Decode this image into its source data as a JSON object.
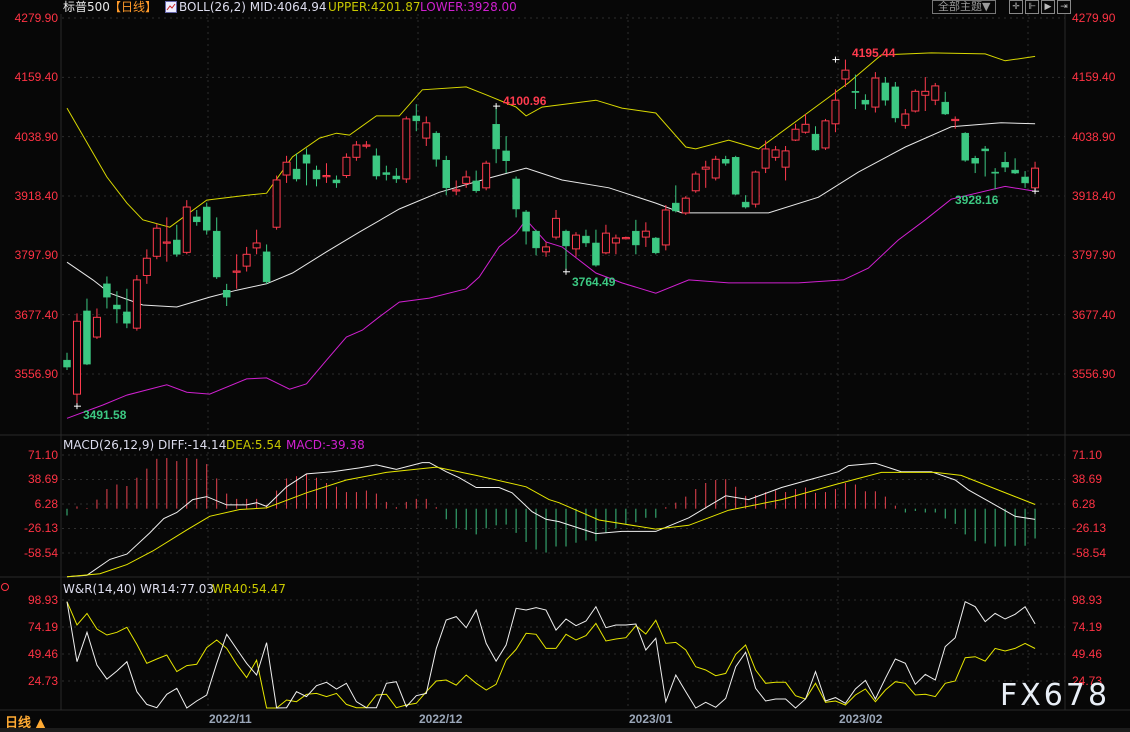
{
  "header": {
    "symbol": "标普500",
    "period": "【日线】",
    "boll": "BOLL(26,2) MID:4064.94",
    "upper": "UPPER:4201.87",
    "lower": "LOWER:3928.00",
    "theme_button": "全部主题▼"
  },
  "macd_header": {
    "name": "MACD(26,12,9) DIFF:-14.14",
    "dea": "DEA:5.54",
    "macd": "MACD:-39.38"
  },
  "wr_header": {
    "name": "W&R(14,40) WR14:77.03",
    "wr40": "WR40:54.47"
  },
  "price_axis": [
    "4279.90",
    "4159.40",
    "4038.90",
    "3918.40",
    "3797.90",
    "3677.40",
    "3556.90"
  ],
  "macd_axis": [
    "71.10",
    "38.69",
    "6.28",
    "-26.13",
    "-58.54"
  ],
  "wr_axis": [
    "98.93",
    "74.19",
    "49.46",
    "24.73"
  ],
  "dates": [
    "2022/11",
    "2022/12",
    "2023/01",
    "2023/02"
  ],
  "period_selector": "日线 ▲",
  "watermark": "FX678",
  "annotations": {
    "high1": "4195.44",
    "high2": "4100.96",
    "low1": "3764.49",
    "low2": "3928.16",
    "low3": "3491.58"
  },
  "colors": {
    "up": "#ff3b4e",
    "down": "#3cc882",
    "mid": "#e8e8e8",
    "upper": "#d8d800",
    "lower": "#d020d0",
    "axis": "#ff3344"
  },
  "chart_data": {
    "type": "candlestick",
    "title": "标普500 日线",
    "price_range": [
      3491.58,
      4279.9
    ],
    "candles_ohlc": [
      [
        3585,
        3600,
        3565,
        3571
      ],
      [
        3516,
        3680,
        3491.58,
        3664
      ],
      [
        3685,
        3710,
        3575,
        3577
      ],
      [
        3632,
        3690,
        3628,
        3672
      ],
      [
        3740,
        3755,
        3690,
        3713
      ],
      [
        3697,
        3725,
        3660,
        3689
      ],
      [
        3683,
        3730,
        3650,
        3660
      ],
      [
        3650,
        3758,
        3645,
        3748
      ],
      [
        3757,
        3810,
        3740,
        3792
      ],
      [
        3796,
        3862,
        3790,
        3853
      ],
      [
        3823,
        3875,
        3785,
        3825
      ],
      [
        3829,
        3860,
        3795,
        3800
      ],
      [
        3804,
        3910,
        3800,
        3896
      ],
      [
        3876,
        3890,
        3858,
        3866
      ],
      [
        3896,
        3905,
        3840,
        3849
      ],
      [
        3847,
        3875,
        3750,
        3754
      ],
      [
        3727,
        3740,
        3695,
        3713
      ],
      [
        3764,
        3800,
        3730,
        3766
      ],
      [
        3776,
        3815,
        3765,
        3800
      ],
      [
        3813,
        3850,
        3800,
        3823
      ],
      [
        3805,
        3820,
        3740,
        3744
      ],
      [
        3855,
        3960,
        3850,
        3951
      ],
      [
        3961,
        4000,
        3945,
        3987
      ],
      [
        3973,
        4005,
        3948,
        3953
      ],
      [
        4002,
        4015,
        3940,
        3985
      ],
      [
        3971,
        3980,
        3938,
        3953
      ],
      [
        3959,
        3985,
        3945,
        3960
      ],
      [
        3951,
        3960,
        3935,
        3945
      ],
      [
        3960,
        4005,
        3955,
        3997
      ],
      [
        3997,
        4030,
        3990,
        4022
      ],
      [
        4020,
        4030,
        4015,
        4022
      ],
      [
        4000,
        4015,
        3952,
        3959
      ],
      [
        3966,
        3980,
        3950,
        3962
      ],
      [
        3959,
        3975,
        3945,
        3953
      ],
      [
        3953,
        4080,
        3945,
        4075
      ],
      [
        4081,
        4105,
        4050,
        4071
      ],
      [
        4036,
        4080,
        4020,
        4067
      ],
      [
        4046,
        4050,
        3978,
        3993
      ],
      [
        3991,
        4000,
        3920,
        3935
      ],
      [
        3929,
        3950,
        3920,
        3931
      ],
      [
        3944,
        3970,
        3935,
        3957
      ],
      [
        3949,
        3970,
        3925,
        3929
      ],
      [
        3935,
        3990,
        3930,
        3985
      ],
      [
        4064,
        4100.96,
        3985,
        4014
      ],
      [
        4010,
        4040,
        3965,
        3990
      ],
      [
        3953,
        3958,
        3875,
        3892
      ],
      [
        3886,
        3890,
        3820,
        3847
      ],
      [
        3847,
        3850,
        3798,
        3813
      ],
      [
        3805,
        3825,
        3795,
        3815
      ],
      [
        3835,
        3890,
        3830,
        3873
      ],
      [
        3847,
        3850,
        3764.49,
        3817
      ],
      [
        3811,
        3845,
        3795,
        3839
      ],
      [
        3837,
        3850,
        3815,
        3823
      ],
      [
        3823,
        3850,
        3775,
        3778
      ],
      [
        3803,
        3860,
        3800,
        3843
      ],
      [
        3823,
        3840,
        3800,
        3833
      ],
      [
        3832,
        3836,
        3830,
        3834
      ],
      [
        3847,
        3870,
        3800,
        3819
      ],
      [
        3835,
        3865,
        3815,
        3847
      ],
      [
        3833,
        3835,
        3800,
        3803
      ],
      [
        3819,
        3900,
        3808,
        3890
      ],
      [
        3904,
        3940,
        3885,
        3888
      ],
      [
        3884,
        3918,
        3880,
        3914
      ],
      [
        3929,
        3968,
        3925,
        3963
      ],
      [
        3973,
        3990,
        3935,
        3977
      ],
      [
        3955,
        4000,
        3950,
        3993
      ],
      [
        3993,
        4000,
        3980,
        3985
      ],
      [
        3997,
        4000,
        3920,
        3922
      ],
      [
        3906,
        3920,
        3893,
        3896
      ],
      [
        3902,
        3970,
        3895,
        3967
      ],
      [
        3975,
        4031,
        3965,
        4014
      ],
      [
        3997,
        4020,
        3990,
        4012
      ],
      [
        3977,
        4020,
        3950,
        4010
      ],
      [
        4032,
        4065,
        4030,
        4054
      ],
      [
        4048,
        4085,
        4045,
        4064
      ],
      [
        4044,
        4060,
        4010,
        4012
      ],
      [
        4016,
        4075,
        4012,
        4071
      ],
      [
        4065,
        4135,
        4048,
        4113
      ],
      [
        4156,
        4195.44,
        4140,
        4174
      ],
      [
        4131,
        4165,
        4095,
        4130
      ],
      [
        4113,
        4125,
        4093,
        4105
      ],
      [
        4099,
        4170,
        4088,
        4158
      ],
      [
        4148,
        4160,
        4102,
        4113
      ],
      [
        4140,
        4150,
        4068,
        4077
      ],
      [
        4062,
        4095,
        4055,
        4085
      ],
      [
        4091,
        4135,
        4088,
        4131
      ],
      [
        4123,
        4160,
        4091,
        4131
      ],
      [
        4113,
        4148,
        4103,
        4142
      ],
      [
        4109,
        4130,
        4083,
        4085
      ],
      [
        4072,
        4080,
        4055,
        4074
      ],
      [
        4046,
        4048,
        3988,
        3991
      ],
      [
        3995,
        4000,
        3965,
        3985
      ],
      [
        4014,
        4020,
        3958,
        4010
      ],
      [
        3967,
        3975,
        3932,
        3966
      ],
      [
        3987,
        4008,
        3967,
        3977
      ],
      [
        3971,
        3995,
        3963,
        3965
      ],
      [
        3957,
        3969,
        3935,
        3945
      ],
      [
        3935,
        3988,
        3928.16,
        3975
      ]
    ],
    "boll_upper": [
      [
        0,
        4097
      ],
      [
        4,
        3957
      ],
      [
        6,
        3904
      ],
      [
        7.6,
        3870
      ],
      [
        10.3,
        3855
      ],
      [
        14,
        3910
      ],
      [
        18,
        3920
      ],
      [
        20,
        3924
      ],
      [
        22.6,
        3998
      ],
      [
        25.3,
        4036
      ],
      [
        27,
        4046
      ],
      [
        28.3,
        4042
      ],
      [
        31,
        4081
      ],
      [
        33.3,
        4081
      ],
      [
        35.6,
        4134
      ],
      [
        40,
        4140
      ],
      [
        42,
        4124
      ],
      [
        45,
        4099
      ],
      [
        46,
        4081
      ],
      [
        47.6,
        4099
      ],
      [
        53,
        4113
      ],
      [
        55.6,
        4097
      ],
      [
        59,
        4087
      ],
      [
        62,
        4018
      ],
      [
        63,
        4014
      ],
      [
        66.3,
        4032
      ],
      [
        69.3,
        4014
      ],
      [
        74.6,
        4093
      ],
      [
        78.3,
        4148
      ],
      [
        81.6,
        4205
      ],
      [
        86.6,
        4209
      ],
      [
        92,
        4207
      ],
      [
        94,
        4193
      ],
      [
        97,
        4201.87
      ]
    ],
    "boll_mid": [
      [
        0,
        3784
      ],
      [
        2.6,
        3748
      ],
      [
        4.3,
        3721
      ],
      [
        7.6,
        3697
      ],
      [
        11,
        3693
      ],
      [
        14.3,
        3713
      ],
      [
        17,
        3727
      ],
      [
        20,
        3740
      ],
      [
        22.6,
        3762
      ],
      [
        26,
        3805
      ],
      [
        29.3,
        3845
      ],
      [
        33.3,
        3892
      ],
      [
        37.3,
        3926
      ],
      [
        42.3,
        3955
      ],
      [
        46,
        3975
      ],
      [
        49.6,
        3951
      ],
      [
        54.3,
        3935
      ],
      [
        59,
        3904
      ],
      [
        61.6,
        3884
      ],
      [
        66.3,
        3884
      ],
      [
        70.3,
        3884
      ],
      [
        75.3,
        3916
      ],
      [
        79.3,
        3967
      ],
      [
        84,
        4018
      ],
      [
        88.6,
        4059
      ],
      [
        93.6,
        4067
      ],
      [
        97,
        4064.94
      ]
    ],
    "boll_lower": [
      [
        0,
        3467
      ],
      [
        3.6,
        3494
      ],
      [
        6,
        3514
      ],
      [
        10,
        3535
      ],
      [
        12,
        3520
      ],
      [
        14.3,
        3516
      ],
      [
        18,
        3547
      ],
      [
        20,
        3549
      ],
      [
        22.3,
        3526
      ],
      [
        24,
        3537
      ],
      [
        26,
        3585
      ],
      [
        28,
        3632
      ],
      [
        29.6,
        3646
      ],
      [
        31.3,
        3673
      ],
      [
        33.3,
        3703
      ],
      [
        36.3,
        3711
      ],
      [
        40,
        3730
      ],
      [
        41.3,
        3754
      ],
      [
        43.3,
        3815
      ],
      [
        45,
        3843
      ],
      [
        46,
        3870
      ],
      [
        48,
        3825
      ],
      [
        49.6,
        3815
      ],
      [
        53,
        3762
      ],
      [
        55.6,
        3742
      ],
      [
        59,
        3721
      ],
      [
        62.3,
        3748
      ],
      [
        66.3,
        3742
      ],
      [
        69.3,
        3742
      ],
      [
        73.3,
        3742
      ],
      [
        77.8,
        3748
      ],
      [
        80.3,
        3772
      ],
      [
        83.3,
        3829
      ],
      [
        86,
        3870
      ],
      [
        88.6,
        3912
      ],
      [
        94,
        3938
      ],
      [
        97,
        3928
      ]
    ],
    "macd_hist": [
      -9,
      3,
      1,
      12,
      26,
      32,
      30,
      41,
      53,
      66,
      67,
      63,
      67,
      66,
      59,
      40,
      20,
      13,
      13,
      13,
      5,
      24,
      40,
      43,
      46,
      41,
      34,
      29,
      22,
      22,
      24,
      20,
      9,
      2,
      9,
      13,
      13,
      2,
      -14,
      -26,
      -28,
      -34,
      -26,
      -22,
      -21,
      -32,
      -44,
      -54,
      -58,
      -50,
      -50,
      -45,
      -42,
      -43,
      -32,
      -26,
      -20,
      -18,
      -12,
      -12,
      2,
      8,
      16,
      26,
      34,
      38,
      39,
      29,
      17,
      18,
      22,
      24,
      22,
      26,
      28,
      21,
      22,
      26,
      34,
      32,
      23,
      23,
      16,
      4,
      -5,
      -3,
      -5,
      -5,
      -13,
      -20,
      -34,
      -43,
      -46,
      -50,
      -50,
      -49,
      -49,
      -39.38
    ],
    "macd_diff": [
      [
        0,
        -90
      ],
      [
        2,
        -88
      ],
      [
        4.3,
        -67
      ],
      [
        6,
        -60
      ],
      [
        8.3,
        -32
      ],
      [
        9.7,
        -13
      ],
      [
        11,
        -5
      ],
      [
        12.6,
        12
      ],
      [
        14,
        16
      ],
      [
        16,
        5
      ],
      [
        18,
        5
      ],
      [
        19,
        8
      ],
      [
        20,
        3
      ],
      [
        22,
        29
      ],
      [
        24,
        46
      ],
      [
        26.6,
        49
      ],
      [
        29.3,
        54
      ],
      [
        31,
        58
      ],
      [
        33,
        52
      ],
      [
        35.6,
        61
      ],
      [
        36.3,
        61
      ],
      [
        38,
        49
      ],
      [
        39.3,
        41
      ],
      [
        41,
        28
      ],
      [
        43.3,
        28
      ],
      [
        44.6,
        21
      ],
      [
        46.6,
        -4
      ],
      [
        48,
        -14
      ],
      [
        49.3,
        -17
      ],
      [
        53,
        -33
      ],
      [
        55.6,
        -30
      ],
      [
        59,
        -30
      ],
      [
        62.3,
        -12
      ],
      [
        66,
        17
      ],
      [
        68.3,
        12
      ],
      [
        71.6,
        28
      ],
      [
        74.3,
        38
      ],
      [
        77.3,
        49
      ],
      [
        78.3,
        57
      ],
      [
        81,
        60
      ],
      [
        83.6,
        49
      ],
      [
        86.6,
        49
      ],
      [
        89,
        38
      ],
      [
        90.3,
        25
      ],
      [
        92.6,
        8
      ],
      [
        95,
        -10
      ],
      [
        97,
        -14.14
      ]
    ],
    "macd_dea": [
      [
        0,
        -90
      ],
      [
        3.3,
        -86
      ],
      [
        6,
        -74
      ],
      [
        8.6,
        -56
      ],
      [
        12,
        -28
      ],
      [
        14.3,
        -10
      ],
      [
        17.3,
        -1
      ],
      [
        20,
        1
      ],
      [
        24,
        21
      ],
      [
        28,
        38
      ],
      [
        32,
        48
      ],
      [
        37,
        55
      ],
      [
        41,
        44
      ],
      [
        46,
        29
      ],
      [
        48.3,
        12
      ],
      [
        49.3,
        8
      ],
      [
        53.3,
        -15
      ],
      [
        59,
        -27
      ],
      [
        62.3,
        -22
      ],
      [
        66.3,
        -2
      ],
      [
        71.6,
        12
      ],
      [
        77,
        32
      ],
      [
        81.6,
        48
      ],
      [
        87,
        48
      ],
      [
        89.6,
        44
      ],
      [
        95,
        16
      ],
      [
        97,
        5.54
      ]
    ],
    "wr14": [
      97.4,
      42.4,
      69.3,
      39.4,
      26.5,
      33.9,
      42.4,
      14.9,
      3.3,
      0.3,
      12.5,
      18,
      0,
      6.4,
      11.9,
      40.9,
      67.5,
      54,
      40.9,
      30.2,
      59.8,
      0,
      0.3,
      14.9,
      10.4,
      20.4,
      23.5,
      17.4,
      22.6,
      5.8,
      0.3,
      0.3,
      22.6,
      24.1,
      1.2,
      11.3,
      13.4,
      54.6,
      80.6,
      83.7,
      73.6,
      89.8,
      59.2,
      43,
      57.7,
      91.3,
      89.8,
      91.9,
      89.8,
      71.4,
      81.5,
      75.4,
      79.7,
      92.8,
      73.6,
      76,
      76,
      76.9,
      53.1,
      63.8,
      5.8,
      30.2,
      14.9,
      0,
      5.2,
      0.6,
      8.8,
      37.8,
      51,
      18,
      6.4,
      8.2,
      8.2,
      0,
      8.2,
      33.3,
      6.4,
      9.5,
      4.3,
      17.4,
      25.3,
      8.2,
      27.2,
      44.9,
      40.9,
      21.7,
      30.8,
      25.6,
      56.2,
      64.4,
      97.4,
      92.8,
      79.1,
      86.7,
      81.5,
      85.8,
      92.8,
      77.03
    ],
    "wr40": [
      97.4,
      76,
      86.7,
      72.4,
      66.9,
      69.3,
      73.9,
      58.3,
      40.9,
      44.9,
      48.5,
      33.3,
      38.8,
      40,
      55.3,
      62.3,
      54.6,
      40,
      27.8,
      43.9,
      0,
      0,
      7.3,
      5.8,
      12.5,
      13.4,
      10.4,
      13.4,
      3.3,
      0.3,
      0.3,
      11.9,
      12.5,
      0.3,
      2.7,
      4.3,
      14.9,
      24.7,
      25.6,
      21,
      30.2,
      22.6,
      16.5,
      21.7,
      43.9,
      53.7,
      68.4,
      67.5,
      54.6,
      54.6,
      67.5,
      62.3,
      66.3,
      77.5,
      61.4,
      63.2,
      64.4,
      75.4,
      67.8,
      80.3,
      59.2,
      60.1,
      53.1,
      37.8,
      34.8,
      29.6,
      31.7,
      49.1,
      57.7,
      34.8,
      22.6,
      23.5,
      23.5,
      11.3,
      8.2,
      22.6,
      5.2,
      6.4,
      2.7,
      11.9,
      17.4,
      5.8,
      16.5,
      24.1,
      22.6,
      11.9,
      12.5,
      10.4,
      22.6,
      24.7,
      46.1,
      47,
      43,
      54.6,
      52.2,
      54.6,
      59.2,
      54.47
    ]
  }
}
